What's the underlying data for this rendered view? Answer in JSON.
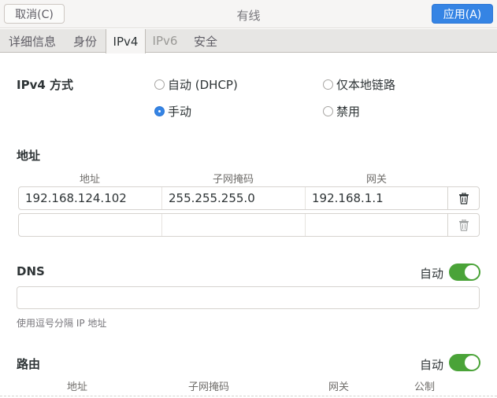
{
  "header": {
    "cancel_label": "取消(C)",
    "title": "有线",
    "apply_label": "应用(A)"
  },
  "tabs": [
    {
      "label": "详细信息",
      "state": "normal"
    },
    {
      "label": "身份",
      "state": "normal"
    },
    {
      "label": "IPv4",
      "state": "active"
    },
    {
      "label": "IPv6",
      "state": "disabled"
    },
    {
      "label": "安全",
      "state": "normal"
    }
  ],
  "ipv4_method": {
    "label": "IPv4 方式",
    "options": [
      {
        "label": "自动 (DHCP)",
        "checked": false
      },
      {
        "label": "仅本地链路",
        "checked": false
      },
      {
        "label": "手动",
        "checked": true
      },
      {
        "label": "禁用",
        "checked": false
      }
    ]
  },
  "addresses": {
    "label": "地址",
    "columns": [
      "地址",
      "子网掩码",
      "网关"
    ],
    "rows": [
      {
        "address": "192.168.124.102",
        "netmask": "255.255.255.0",
        "gateway": "192.168.1.1"
      },
      {
        "address": "",
        "netmask": "",
        "gateway": ""
      }
    ]
  },
  "dns": {
    "label": "DNS",
    "auto_label": "自动",
    "auto_enabled": true,
    "value": "",
    "hint": "使用逗号分隔 IP 地址"
  },
  "routes": {
    "label": "路由",
    "auto_label": "自动",
    "auto_enabled": true,
    "columns": [
      "地址",
      "子网掩码",
      "网关",
      "公制"
    ]
  },
  "colors": {
    "accent": "#3584e4",
    "switch_on": "#4aa338"
  },
  "icons": {
    "trash": "trash-icon"
  }
}
